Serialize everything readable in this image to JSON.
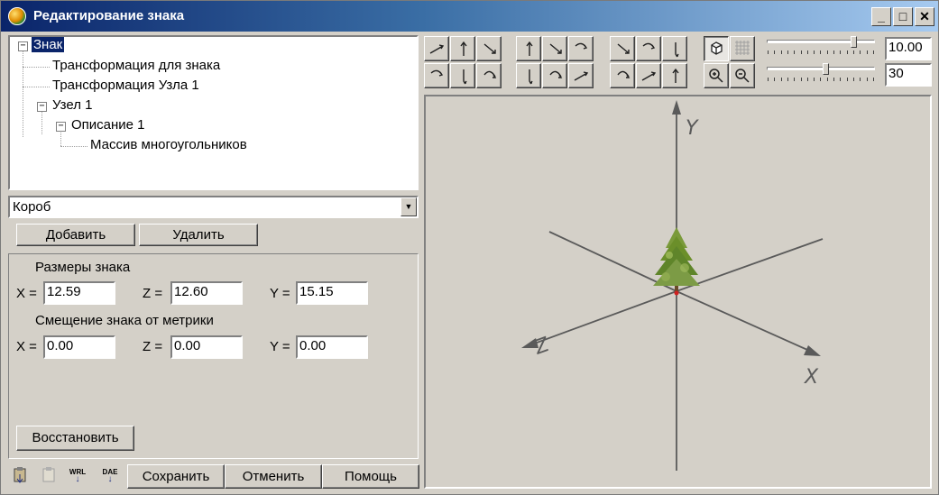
{
  "window": {
    "title": "Редактирование знака"
  },
  "tree": {
    "nodes": [
      "Знак",
      "Трансформация для знака",
      "Трансформация Узла 1",
      "Узел 1",
      "Описание 1",
      "Массив многоугольников"
    ]
  },
  "type_combo": {
    "value": "Короб"
  },
  "buttons": {
    "add": "Добавить",
    "delete": "Удалить",
    "restore": "Восстановить",
    "save": "Сохранить",
    "cancel": "Отменить",
    "help": "Помощь"
  },
  "size_group": {
    "title": "Размеры знака",
    "x_label": "X =",
    "x_value": "12.59",
    "z_label": "Z =",
    "z_value": "12.60",
    "y_label": "Y =",
    "y_value": "15.15"
  },
  "offset_group": {
    "title": "Смещение знака от метрики",
    "x_label": "X =",
    "x_value": "0.00",
    "z_label": "Z =",
    "z_value": "0.00",
    "y_label": "Y =",
    "y_value": "0.00"
  },
  "bottom_icons": {
    "wrl": "WRL",
    "dae": "DAE"
  },
  "view_controls": {
    "scale_value": "10.00",
    "scale_slider_level": 0.82,
    "angle_value": "30",
    "angle_slider_level": 0.55
  },
  "axes": {
    "y": "Y",
    "z": "Z",
    "x": "X"
  },
  "colors": {
    "title_start": "#0a246a",
    "title_end": "#a6caf0",
    "selection": "#0a246a",
    "axis": "#5a5a5a",
    "tree_green": "#6b8f2a"
  }
}
